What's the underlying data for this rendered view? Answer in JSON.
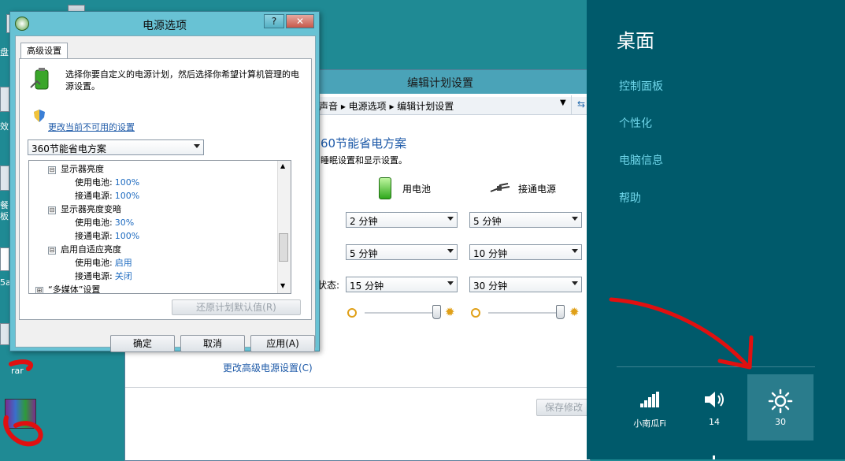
{
  "dialog": {
    "title": "电源选项",
    "help_btn": "?",
    "close_btn": "✕",
    "tab": "高级设置",
    "intro": "选择你要自定义的电源计划，然后选择你希望计算机管理的电源设置。",
    "change_link": "更改当前不可用的设置",
    "plan_select": "360节能省电方案",
    "tree": [
      {
        "kind": "group",
        "sign": "⊟",
        "label": "显示器亮度"
      },
      {
        "kind": "value",
        "label": "使用电池:",
        "value": "100%"
      },
      {
        "kind": "value",
        "label": "接通电源:",
        "value": "100%"
      },
      {
        "kind": "group",
        "sign": "⊟",
        "label": "显示器亮度变暗"
      },
      {
        "kind": "value",
        "label": "使用电池:",
        "value": "30%"
      },
      {
        "kind": "value",
        "label": "接通电源:",
        "value": "100%"
      },
      {
        "kind": "group",
        "sign": "⊟",
        "label": "启用自适应亮度"
      },
      {
        "kind": "value",
        "label": "使用电池:",
        "value": "启用"
      },
      {
        "kind": "value",
        "label": "接通电源:",
        "value": "关闭"
      },
      {
        "kind": "group",
        "sign": "⊞",
        "label": "“多媒体”设置"
      }
    ],
    "restore_btn": "还原计划默认值(R)",
    "ok_btn": "确定",
    "cancel_btn": "取消",
    "apply_btn": "应用(A)"
  },
  "edit_window": {
    "title": "编辑计划设置",
    "breadcrumb": "声音  ▸  电源选项  ▸  编辑计划设置",
    "plan_name": "60节能省电方案",
    "plan_desc": "睡眠设置和显示设置。",
    "col_battery": "用电池",
    "col_plugged": "接通电源",
    "row3_label": "状态:",
    "selects": {
      "r1_battery": "2 分钟",
      "r1_plugged": "5 分钟",
      "r2_battery": "5 分钟",
      "r2_plugged": "10 分钟",
      "r3_battery": "15 分钟",
      "r3_plugged": "30 分钟"
    },
    "brightness_battery_level": 0.95,
    "brightness_plugged_level": 0.95,
    "advanced_link": "更改高级电源设置(C)",
    "save_btn": "保存修改"
  },
  "charms": {
    "heading": "桌面",
    "items": [
      "控制面板",
      "个性化",
      "电脑信息",
      "帮助"
    ],
    "tiles": [
      {
        "icon": "signal-icon",
        "label": "小南瓜Fi"
      },
      {
        "icon": "volume-icon",
        "label": "14"
      },
      {
        "icon": "brightness-icon",
        "label": "30"
      }
    ]
  },
  "desktop": {
    "icon_labels": [
      "盘",
      "效",
      "餐",
      "板",
      "5a",
      "rar"
    ]
  },
  "colors": {
    "desktop": "#1f8a94",
    "charms_bg": "#005a6b",
    "charms_link": "#6fd6ea",
    "annotation": "#e01010"
  }
}
